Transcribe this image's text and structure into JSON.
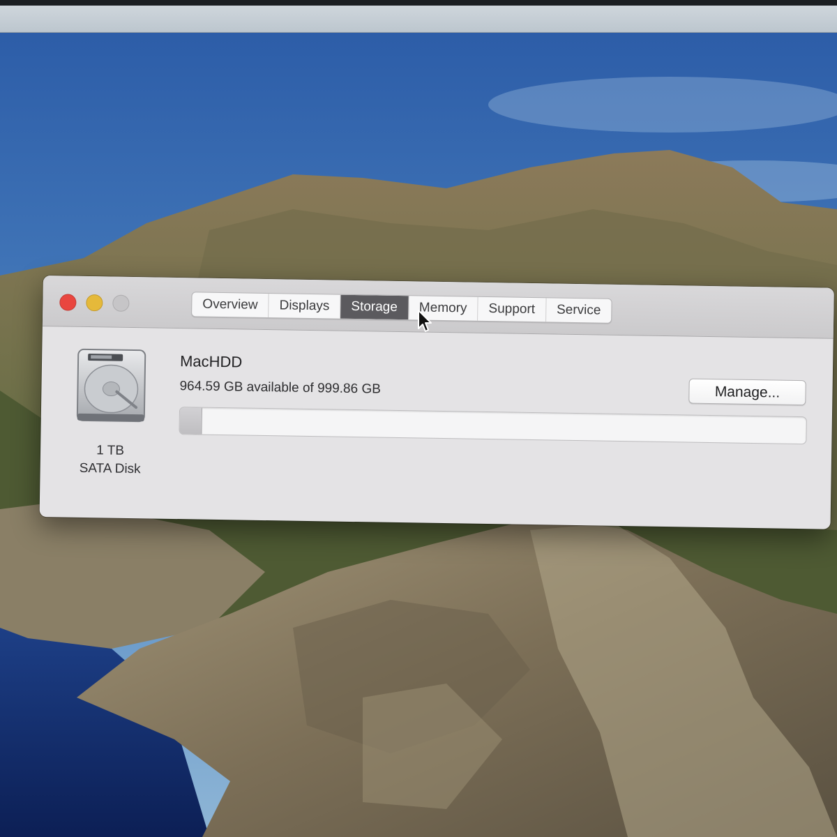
{
  "window": {
    "tabs": [
      {
        "label": "Overview",
        "active": false
      },
      {
        "label": "Displays",
        "active": false
      },
      {
        "label": "Storage",
        "active": true
      },
      {
        "label": "Memory",
        "active": false
      },
      {
        "label": "Support",
        "active": false
      },
      {
        "label": "Service",
        "active": false
      }
    ],
    "traffic_lights": {
      "close": "#e9463f",
      "minimize": "#e5b93a",
      "zoom": "#c6c5c7"
    }
  },
  "storage": {
    "disk": {
      "icon": "hard-disk-icon",
      "capacity": "1 TB",
      "type": "SATA Disk"
    },
    "volume": {
      "name": "MacHDD",
      "availability": "964.59 GB available of 999.86 GB",
      "used_fraction": 0.035
    },
    "manage_label": "Manage..."
  },
  "colors": {
    "active_tab": "#5b5a5e",
    "window_bg": "#e4e3e5",
    "sky": "#2e5ea7"
  }
}
